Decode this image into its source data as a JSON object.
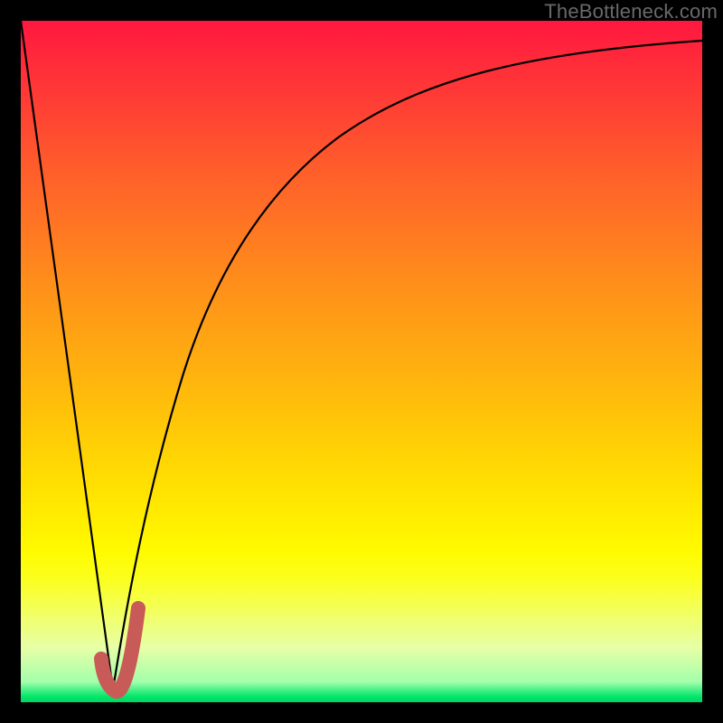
{
  "watermark": "TheBottleneck.com",
  "colors": {
    "frame": "#000000",
    "gradient_top": "#ff173f",
    "gradient_mid": "#ffe000",
    "gradient_bottom": "#00e66a",
    "curve_stroke": "#000000",
    "marker_stroke": "#c85a57"
  },
  "chart_data": {
    "type": "line",
    "title": "",
    "xlabel": "",
    "ylabel": "",
    "xlim": [
      0,
      100
    ],
    "ylim": [
      0,
      100
    ],
    "series": [
      {
        "name": "left-descent",
        "x": [
          0,
          13.5
        ],
        "y": [
          100,
          2
        ]
      },
      {
        "name": "right-ascent",
        "x": [
          13.5,
          18,
          24,
          32,
          42,
          55,
          70,
          85,
          100
        ],
        "y": [
          2,
          25,
          48,
          66,
          79,
          87,
          92,
          95,
          97
        ]
      },
      {
        "name": "marker-j",
        "x": [
          11.8,
          12.4,
          13.2,
          14.2,
          15.0,
          15.6,
          16.5,
          17.2
        ],
        "y": [
          6.0,
          3.2,
          1.6,
          1.6,
          3.3,
          6.0,
          10.0,
          14.0
        ]
      }
    ],
    "annotations": [
      {
        "text": "TheBottleneck.com",
        "position": "top-right"
      }
    ]
  }
}
